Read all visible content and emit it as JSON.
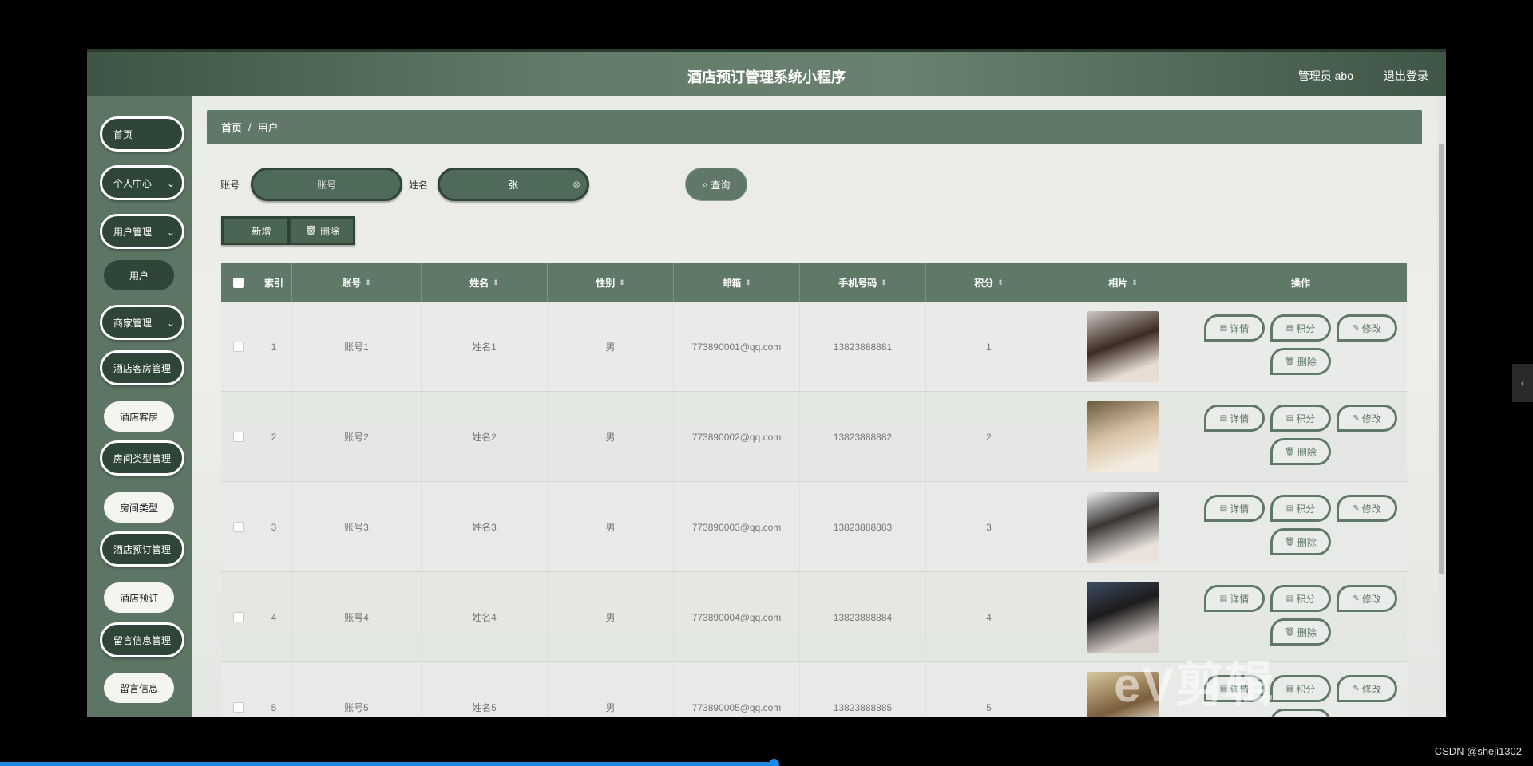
{
  "header": {
    "title": "酒店预订管理系统小程序",
    "admin": "管理员 abo",
    "logout": "退出登录"
  },
  "sidebar": {
    "items": [
      {
        "label": "首页"
      },
      {
        "label": "个人中心"
      },
      {
        "label": "用户管理"
      },
      {
        "label": "用户"
      },
      {
        "label": "商家管理"
      },
      {
        "label": "酒店客房管理"
      },
      {
        "label": "酒店客房"
      },
      {
        "label": "房间类型管理"
      },
      {
        "label": "房间类型"
      },
      {
        "label": "酒店预订管理"
      },
      {
        "label": "酒店预订"
      },
      {
        "label": "留言信息管理"
      },
      {
        "label": "留言信息"
      }
    ]
  },
  "breadcrumb": {
    "home": "首页",
    "sep": "/",
    "current": "用户"
  },
  "search": {
    "account_label": "账号",
    "account_placeholder": "账号",
    "name_label": "姓名",
    "name_value": "张",
    "query_label": "查询"
  },
  "toolbar": {
    "add_label": "新增",
    "delete_label": "删除"
  },
  "table": {
    "headers": {
      "index": "索引",
      "account": "账号",
      "name": "姓名",
      "gender": "性别",
      "email": "邮箱",
      "phone": "手机号码",
      "points": "积分",
      "photo": "相片",
      "ops": "操作"
    },
    "rows": [
      {
        "index": "1",
        "account": "账号1",
        "name": "姓名1",
        "gender": "男",
        "email": "773890001@qq.com",
        "phone": "13823888881",
        "points": "1"
      },
      {
        "index": "2",
        "account": "账号2",
        "name": "姓名2",
        "gender": "男",
        "email": "773890002@qq.com",
        "phone": "13823888882",
        "points": "2"
      },
      {
        "index": "3",
        "account": "账号3",
        "name": "姓名3",
        "gender": "男",
        "email": "773890003@qq.com",
        "phone": "13823888883",
        "points": "3"
      },
      {
        "index": "4",
        "account": "账号4",
        "name": "姓名4",
        "gender": "男",
        "email": "773890004@qq.com",
        "phone": "13823888884",
        "points": "4"
      },
      {
        "index": "5",
        "account": "账号5",
        "name": "姓名5",
        "gender": "男",
        "email": "773890005@qq.com",
        "phone": "13823888885",
        "points": "5"
      }
    ],
    "ops": {
      "detail": "详情",
      "points": "积分",
      "edit": "修改",
      "delete": "删除"
    }
  },
  "footer": {
    "credit": "CSDN @sheji1302",
    "watermark": "eV剪辑"
  },
  "colors": {
    "primary": "#5f7867",
    "dark": "#2f4537",
    "header": "#4b6553"
  }
}
